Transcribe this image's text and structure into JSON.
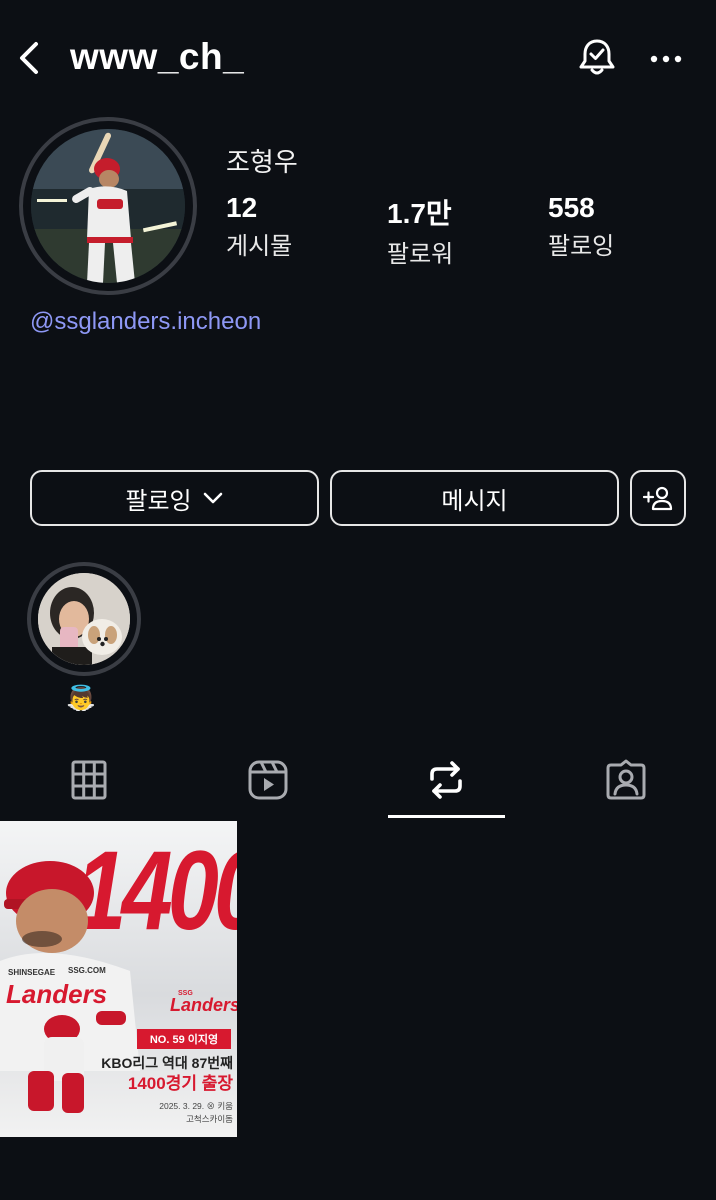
{
  "header": {
    "username": "www_ch_"
  },
  "profile": {
    "full_name": "조형우",
    "stats": [
      {
        "value": "12",
        "label": "게시물"
      },
      {
        "value": "1.7만",
        "label": "팔로워"
      },
      {
        "value": "558",
        "label": "팔로잉"
      }
    ],
    "mention": "@ssglanders.incheon"
  },
  "actions": {
    "following_label": "팔로잉",
    "message_label": "메시지"
  },
  "highlight": {
    "label": "👼"
  },
  "tabs": [
    {
      "icon": "grid-icon",
      "active": false
    },
    {
      "icon": "reels-icon",
      "active": false
    },
    {
      "icon": "repost-icon",
      "active": true
    },
    {
      "icon": "tagged-icon",
      "active": false
    }
  ],
  "post": {
    "big_number": "1400",
    "logo_small": "SSG",
    "logo_text": "Landers",
    "badge": "NO. 59 이지영",
    "line1": "KBO리그 역대 87번째",
    "line2": "1400경기 출장",
    "date": "2025. 3. 29. ⊗ 키움",
    "venue": "고척스카이돔",
    "colors": {
      "red": "#d7192f"
    }
  }
}
